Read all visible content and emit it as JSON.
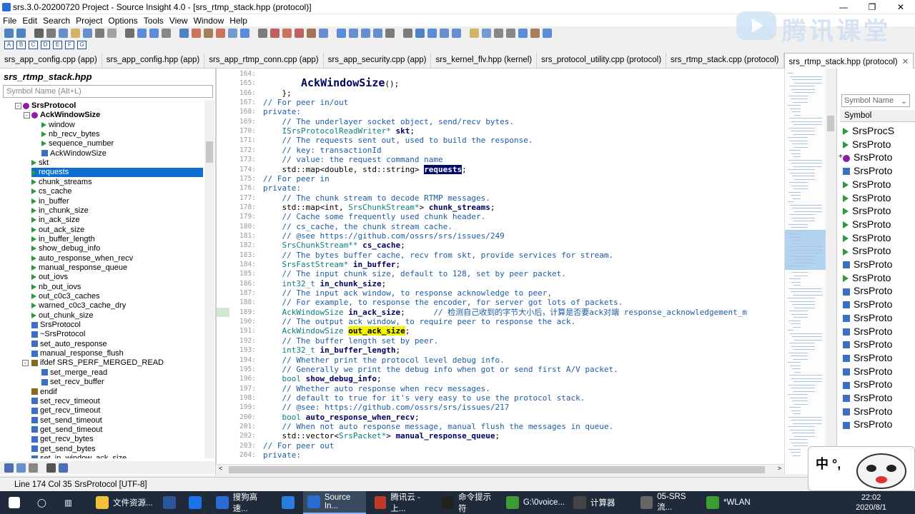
{
  "window": {
    "title": "srs.3.0-20200720 Project - Source Insight 4.0 - [srs_rtmp_stack.hpp (protocol)]"
  },
  "menu": [
    "File",
    "Edit",
    "Search",
    "Project",
    "Options",
    "Tools",
    "View",
    "Window",
    "Help"
  ],
  "watermark": "腾讯课堂",
  "tabs": [
    {
      "label": "srs_app_config.cpp (app)",
      "active": false
    },
    {
      "label": "srs_app_config.hpp (app)",
      "active": false
    },
    {
      "label": "srs_app_rtmp_conn.cpp (app)",
      "active": false
    },
    {
      "label": "srs_app_security.cpp (app)",
      "active": false
    },
    {
      "label": "srs_kernel_flv.hpp (kernel)",
      "active": false
    },
    {
      "label": "srs_protocol_utility.cpp (protocol)",
      "active": false
    },
    {
      "label": "srs_rtmp_stack.cpp (protocol)",
      "active": false
    },
    {
      "label": "srs_rtmp_stack.hpp (protocol)",
      "active": true
    }
  ],
  "left_panel": {
    "title": "srs_rtmp_stack.hpp",
    "search_placeholder": "Symbol Name (Alt+L)",
    "tree": [
      {
        "label": "SrsProtocol",
        "level": 0,
        "bold": true,
        "icon": "class",
        "expander": "-"
      },
      {
        "label": "AckWindowSize",
        "level": 1,
        "bold": true,
        "icon": "class",
        "expander": "-"
      },
      {
        "label": "window",
        "level": 2,
        "icon": "field"
      },
      {
        "label": "nb_recv_bytes",
        "level": 2,
        "icon": "field"
      },
      {
        "label": "sequence_number",
        "level": 2,
        "icon": "field"
      },
      {
        "label": "AckWindowSize",
        "level": 2,
        "icon": "method"
      },
      {
        "label": "skt",
        "level": 1,
        "icon": "field"
      },
      {
        "label": "requests",
        "level": 1,
        "icon": "field",
        "selected": true
      },
      {
        "label": "chunk_streams",
        "level": 1,
        "icon": "field"
      },
      {
        "label": "cs_cache",
        "level": 1,
        "icon": "field"
      },
      {
        "label": "in_buffer",
        "level": 1,
        "icon": "field"
      },
      {
        "label": "in_chunk_size",
        "level": 1,
        "icon": "field"
      },
      {
        "label": "in_ack_size",
        "level": 1,
        "icon": "field"
      },
      {
        "label": "out_ack_size",
        "level": 1,
        "icon": "field"
      },
      {
        "label": "in_buffer_length",
        "level": 1,
        "icon": "field"
      },
      {
        "label": "show_debug_info",
        "level": 1,
        "icon": "field"
      },
      {
        "label": "auto_response_when_recv",
        "level": 1,
        "icon": "field"
      },
      {
        "label": "manual_response_queue",
        "level": 1,
        "icon": "field"
      },
      {
        "label": "out_iovs",
        "level": 1,
        "icon": "field"
      },
      {
        "label": "nb_out_iovs",
        "level": 1,
        "icon": "field"
      },
      {
        "label": "out_c0c3_caches",
        "level": 1,
        "icon": "field"
      },
      {
        "label": "warned_c0c3_cache_dry",
        "level": 1,
        "icon": "field"
      },
      {
        "label": "out_chunk_size",
        "level": 1,
        "icon": "field"
      },
      {
        "label": "SrsProtocol",
        "level": 1,
        "icon": "method"
      },
      {
        "label": "~SrsProtocol",
        "level": 1,
        "icon": "method"
      },
      {
        "label": "set_auto_response",
        "level": 1,
        "icon": "method"
      },
      {
        "label": "manual_response_flush",
        "level": 1,
        "icon": "method"
      },
      {
        "label": "ifdef SRS_PERF_MERGED_READ",
        "level": 1,
        "icon": "ifdef",
        "expander": "-"
      },
      {
        "label": "set_merge_read",
        "level": 2,
        "icon": "method"
      },
      {
        "label": "set_recv_buffer",
        "level": 2,
        "icon": "method"
      },
      {
        "label": "endif",
        "level": 1,
        "icon": "ifdef"
      },
      {
        "label": "set_recv_timeout",
        "level": 1,
        "icon": "method"
      },
      {
        "label": "get_recv_timeout",
        "level": 1,
        "icon": "method"
      },
      {
        "label": "set_send_timeout",
        "level": 1,
        "icon": "method"
      },
      {
        "label": "get_send_timeout",
        "level": 1,
        "icon": "method"
      },
      {
        "label": "get_recv_bytes",
        "level": 1,
        "icon": "method"
      },
      {
        "label": "get_send_bytes",
        "level": 1,
        "icon": "method"
      },
      {
        "label": "set_in_window_ack_size",
        "level": 1,
        "icon": "method"
      }
    ]
  },
  "code_lines": [
    {
      "n": "164:",
      "segs": [
        [
          "",
          ""
        ]
      ]
    },
    {
      "n": "165:",
      "segs": [
        [
          "        ",
          ""
        ],
        [
          "AckWindowSize",
          "big"
        ],
        [
          "();",
          ""
        ]
      ]
    },
    {
      "n": "166:",
      "segs": [
        [
          "    };",
          ""
        ]
      ]
    },
    {
      "n": "167:",
      "segs": [
        [
          "// For peer in/out",
          "cm"
        ]
      ]
    },
    {
      "n": "168:",
      "segs": [
        [
          "private:",
          "kw"
        ]
      ]
    },
    {
      "n": "169:",
      "segs": [
        [
          "    // The underlayer socket object, send/recv bytes.",
          "cm"
        ]
      ]
    },
    {
      "n": "170:",
      "segs": [
        [
          "    ",
          ""
        ],
        [
          "ISrsProtocolReadWriter*",
          "ty"
        ],
        [
          " ",
          ""
        ],
        [
          "skt",
          "id"
        ],
        [
          ";",
          ""
        ]
      ]
    },
    {
      "n": "171:",
      "segs": [
        [
          "    // The requests sent out, used to build the response.",
          "cm"
        ]
      ]
    },
    {
      "n": "172:",
      "segs": [
        [
          "    // key: transactionId",
          "cm"
        ]
      ]
    },
    {
      "n": "173:",
      "segs": [
        [
          "    // value: the request command name",
          "cm"
        ]
      ]
    },
    {
      "n": "174:",
      "segs": [
        [
          "    std::map<",
          ""
        ],
        [
          "double",
          ""
        ],
        [
          ", std::string> ",
          ""
        ],
        [
          "requests",
          "sel"
        ],
        [
          ";",
          ""
        ]
      ]
    },
    {
      "n": "175:",
      "segs": [
        [
          "// For peer in",
          "cm"
        ]
      ]
    },
    {
      "n": "176:",
      "segs": [
        [
          "private:",
          "kw"
        ]
      ]
    },
    {
      "n": "177:",
      "segs": [
        [
          "    // The chunk stream to decode RTMP messages.",
          "cm"
        ]
      ]
    },
    {
      "n": "178:",
      "segs": [
        [
          "    std::map<",
          ""
        ],
        [
          "int",
          ""
        ],
        [
          ", ",
          ""
        ],
        [
          "SrsChunkStream*",
          "ty"
        ],
        [
          "> ",
          ""
        ],
        [
          "chunk_streams",
          "id"
        ],
        [
          ";",
          ""
        ]
      ]
    },
    {
      "n": "179:",
      "segs": [
        [
          "    // Cache some frequently used chunk header.",
          "cm"
        ]
      ]
    },
    {
      "n": "180:",
      "segs": [
        [
          "    // cs_cache, the chunk stream cache.",
          "cm"
        ]
      ]
    },
    {
      "n": "181:",
      "segs": [
        [
          "    // @see https://github.com/ossrs/srs/issues/249",
          "cm"
        ]
      ]
    },
    {
      "n": "182:",
      "segs": [
        [
          "    ",
          ""
        ],
        [
          "SrsChunkStream**",
          "ty"
        ],
        [
          " ",
          ""
        ],
        [
          "cs_cache",
          "id"
        ],
        [
          ";",
          ""
        ]
      ]
    },
    {
      "n": "183:",
      "segs": [
        [
          "    // The bytes buffer cache, recv from skt, provide services for stream.",
          "cm"
        ]
      ]
    },
    {
      "n": "184:",
      "segs": [
        [
          "    ",
          ""
        ],
        [
          "SrsFastStream*",
          "ty"
        ],
        [
          " ",
          ""
        ],
        [
          "in_buffer",
          "id"
        ],
        [
          ";",
          ""
        ]
      ]
    },
    {
      "n": "185:",
      "segs": [
        [
          "    // The input chunk size, default to 128, set by peer packet.",
          "cm"
        ]
      ]
    },
    {
      "n": "186:",
      "segs": [
        [
          "    ",
          ""
        ],
        [
          "int32_t",
          "ty"
        ],
        [
          " ",
          ""
        ],
        [
          "in_chunk_size",
          "id"
        ],
        [
          ";",
          ""
        ]
      ]
    },
    {
      "n": "187:",
      "segs": [
        [
          "    // The input ack window, to response acknowledge to peer,",
          "cm"
        ]
      ]
    },
    {
      "n": "188:",
      "segs": [
        [
          "    // For example, to response the encoder, for server got lots of packets.",
          "cm"
        ]
      ]
    },
    {
      "n": "189:",
      "segs": [
        [
          "    ",
          ""
        ],
        [
          "AckWindowSize",
          "ty"
        ],
        [
          " ",
          ""
        ],
        [
          "in_ack_size",
          "id"
        ],
        [
          ";      ",
          ""
        ],
        [
          "// 检测自己收到的字节大小后，计算是否要ack对端 response_acknowledgement_m",
          "cm"
        ]
      ]
    },
    {
      "n": "190:",
      "segs": [
        [
          "    // The output ack window, to require peer to response the ack.",
          "cm"
        ]
      ]
    },
    {
      "n": "191:",
      "segs": [
        [
          "    ",
          ""
        ],
        [
          "AckWindowSize",
          "ty"
        ],
        [
          " ",
          ""
        ],
        [
          "out_ack_size",
          "yel"
        ],
        [
          ";",
          ""
        ]
      ]
    },
    {
      "n": "192:",
      "segs": [
        [
          "    // The buffer length set by peer.",
          "cm"
        ]
      ]
    },
    {
      "n": "193:",
      "segs": [
        [
          "    ",
          ""
        ],
        [
          "int32_t",
          "ty"
        ],
        [
          " ",
          ""
        ],
        [
          "in_buffer_length",
          "id"
        ],
        [
          ";",
          ""
        ]
      ]
    },
    {
      "n": "194:",
      "segs": [
        [
          "    // Whether print the protocol level debug info.",
          "cm"
        ]
      ]
    },
    {
      "n": "195:",
      "segs": [
        [
          "    // Generally we print the debug info when got or send first A/V packet.",
          "cm"
        ]
      ]
    },
    {
      "n": "196:",
      "segs": [
        [
          "    ",
          ""
        ],
        [
          "bool",
          "ty"
        ],
        [
          " ",
          ""
        ],
        [
          "show_debug_info",
          "id"
        ],
        [
          ";",
          ""
        ]
      ]
    },
    {
      "n": "197:",
      "segs": [
        [
          "    // Whether auto response when recv messages.",
          "cm"
        ]
      ]
    },
    {
      "n": "198:",
      "segs": [
        [
          "    // default to true for it's very easy to use the protocol stack.",
          "cm"
        ]
      ]
    },
    {
      "n": "199:",
      "segs": [
        [
          "    // @see: https://github.com/ossrs/srs/issues/217",
          "cm"
        ]
      ]
    },
    {
      "n": "200:",
      "segs": [
        [
          "    ",
          ""
        ],
        [
          "bool",
          "ty"
        ],
        [
          " ",
          ""
        ],
        [
          "auto_response_when_recv",
          "id"
        ],
        [
          ";",
          ""
        ]
      ]
    },
    {
      "n": "201:",
      "segs": [
        [
          "    // When not auto response message, manual flush the messages in queue.",
          "cm"
        ]
      ]
    },
    {
      "n": "202:",
      "segs": [
        [
          "    std::vector<",
          ""
        ],
        [
          "SrsPacket*",
          "ty"
        ],
        [
          "> ",
          ""
        ],
        [
          "manual_response_queue",
          "id"
        ],
        [
          ";",
          ""
        ]
      ]
    },
    {
      "n": "203:",
      "segs": [
        [
          "// For peer out",
          "cm"
        ]
      ]
    },
    {
      "n": "204:",
      "segs": [
        [
          "private:",
          "kw"
        ]
      ]
    }
  ],
  "right_panel": {
    "select_label": "Symbol Name",
    "column_header": "Symbol",
    "items": [
      {
        "label": "SrsProcS",
        "icon": "field"
      },
      {
        "label": "SrsProto",
        "icon": "field"
      },
      {
        "label": "SrsProto",
        "icon": "class"
      },
      {
        "label": "SrsProto",
        "icon": "method"
      },
      {
        "label": "SrsProto",
        "icon": "field"
      },
      {
        "label": "SrsProto",
        "icon": "field"
      },
      {
        "label": "SrsProto",
        "icon": "field"
      },
      {
        "label": "SrsProto",
        "icon": "field"
      },
      {
        "label": "SrsProto",
        "icon": "field"
      },
      {
        "label": "SrsProto",
        "icon": "field"
      },
      {
        "label": "SrsProto",
        "icon": "method"
      },
      {
        "label": "SrsProto",
        "icon": "field"
      },
      {
        "label": "SrsProto",
        "icon": "method"
      },
      {
        "label": "SrsProto",
        "icon": "method"
      },
      {
        "label": "SrsProto",
        "icon": "method"
      },
      {
        "label": "SrsProto",
        "icon": "method"
      },
      {
        "label": "SrsProto",
        "icon": "method"
      },
      {
        "label": "SrsProto",
        "icon": "method"
      },
      {
        "label": "SrsProto",
        "icon": "method"
      },
      {
        "label": "SrsProto",
        "icon": "method"
      },
      {
        "label": "SrsProto",
        "icon": "method"
      },
      {
        "label": "SrsProto",
        "icon": "method"
      },
      {
        "label": "SrsProto",
        "icon": "method"
      }
    ]
  },
  "status": {
    "position": "Line 174  Col 35",
    "context": "SrsProtocol [UTF-8]"
  },
  "avatar_text": "中 °,",
  "taskbar": {
    "items": [
      {
        "label": "文件资源...",
        "color": "#f3c13a"
      },
      {
        "label": "",
        "color": "#2b579a"
      },
      {
        "label": "",
        "color": "#1a73e8"
      },
      {
        "label": "搜狗高速...",
        "color": "#2a6bd1"
      },
      {
        "label": "",
        "color": "#2d7de0"
      },
      {
        "label": "Source In...",
        "color": "#2a6bd1",
        "active": true
      },
      {
        "label": "腾讯云 - 上...",
        "color": "#c0392b"
      },
      {
        "label": "命令提示符",
        "color": "#222"
      },
      {
        "label": "G:\\0voice...",
        "color": "#3d9b35"
      },
      {
        "label": "计算器",
        "color": "#444"
      },
      {
        "label": "05-SRS流...",
        "color": "#666"
      },
      {
        "label": "*WLAN",
        "color": "#3d9b35"
      }
    ],
    "time": "22:02",
    "date": "2020/8/1"
  },
  "colors": {
    "selection": "#0c6fd1",
    "highlight": "#f4f400",
    "comment": "#1c5ca8",
    "type": "#0a7f7f"
  }
}
